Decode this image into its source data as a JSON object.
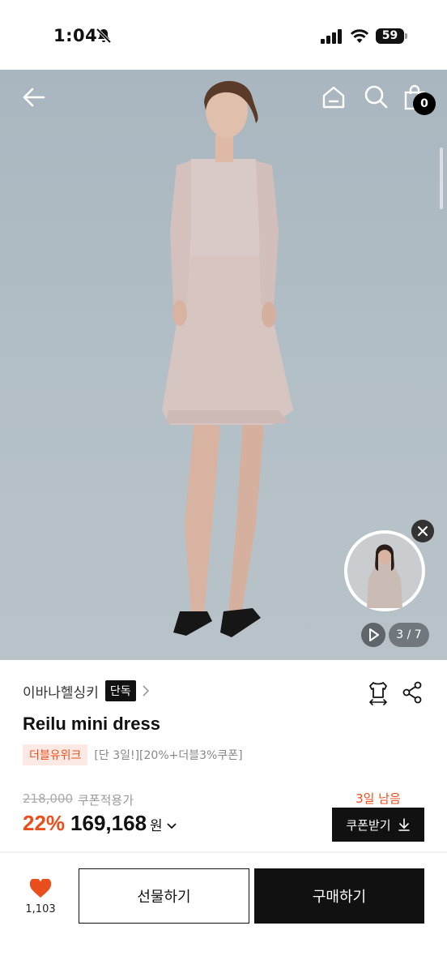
{
  "status_bar": {
    "time": "1:04",
    "battery": "59"
  },
  "hero": {
    "cart_count": "0",
    "page_counter": "3 / 7"
  },
  "product": {
    "brand": "이바나헬싱키",
    "exclusive_badge": "단독",
    "title": "Reilu mini dress",
    "promo_badge": "더블유위크",
    "promo_text": "[단 3일!][20%+더블3%쿠폰]",
    "original_price": "218,000",
    "coupon_applied_label": "쿠폰적용가",
    "discount_rate": "22%",
    "sale_price": "169,168",
    "currency": "원",
    "days_left": "3일 남음",
    "coupon_button": "쿠폰받기"
  },
  "bottom_bar": {
    "like_count": "1,103",
    "gift_button": "선물하기",
    "buy_button": "구매하기"
  },
  "colors": {
    "accent": "#ea4e1c",
    "dark": "#111111",
    "promo_bg": "#fde9e3"
  },
  "icons": [
    "mute-icon",
    "signal-icon",
    "wifi-icon",
    "back-arrow-icon",
    "home-icon",
    "search-icon",
    "cart-icon",
    "close-icon",
    "play-icon",
    "hanger-size-icon",
    "share-icon",
    "chevron-right-icon",
    "chevron-down-icon",
    "download-icon",
    "heart-icon"
  ]
}
